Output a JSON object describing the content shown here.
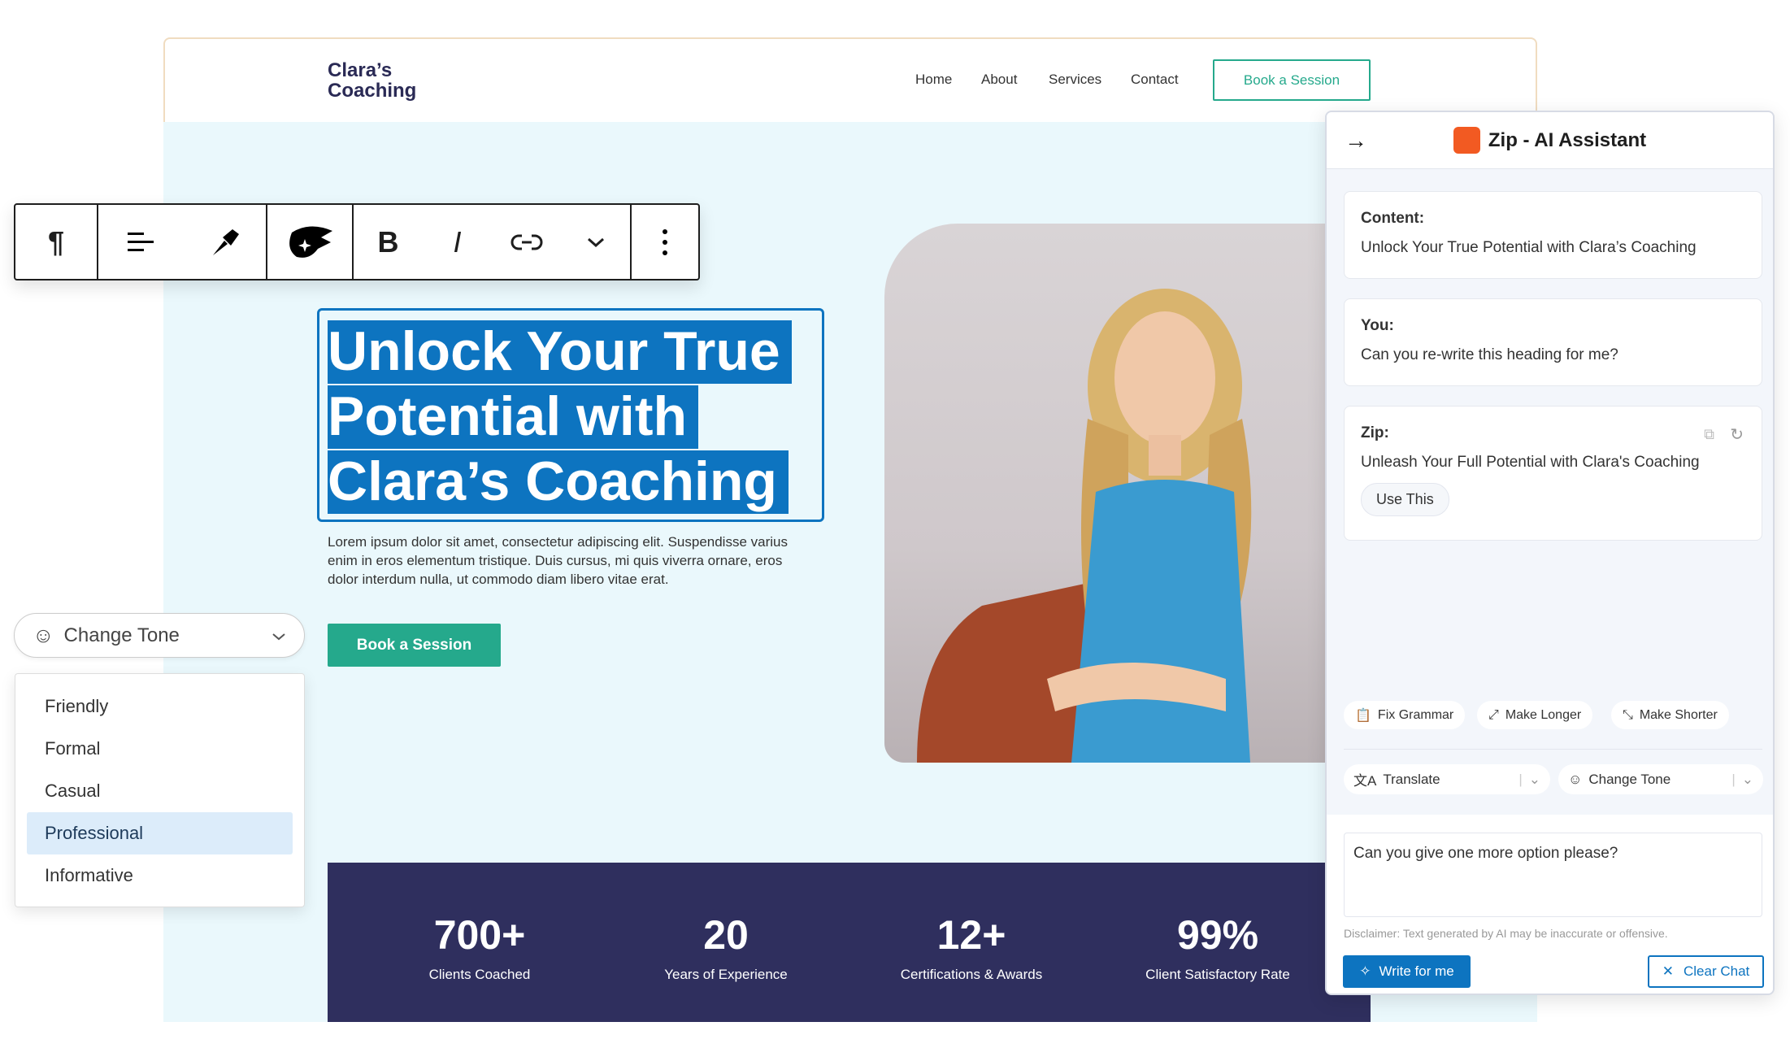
{
  "site": {
    "logo": "Clara’s Coaching",
    "nav": [
      "Home",
      "About",
      "Services",
      "Contact"
    ],
    "header_button": "Book a Session",
    "heading_lines": [
      "Unlock Your True",
      "Potential with",
      "Clara’s Coaching"
    ],
    "paragraph": "Lorem ipsum dolor sit amet, consectetur adipiscing elit. Suspendisse varius enim in eros elementum tristique. Duis cursus, mi quis viverra ornare, eros dolor interdum nulla, ut commodo diam libero vitae erat.",
    "hero_button": "Book a Session",
    "stats": [
      {
        "value": "700+",
        "label": "Clients Coached"
      },
      {
        "value": "20",
        "label": "Years of Experience"
      },
      {
        "value": "12+",
        "label": "Certifications & Awards"
      },
      {
        "value": "99%",
        "label": "Client Satisfactory Rate"
      }
    ]
  },
  "toolbar": {
    "icons": [
      "paragraph-icon",
      "align-icon",
      "paintbrush-icon",
      "zip-ai-icon",
      "bold-icon",
      "italic-icon",
      "link-icon",
      "chevron-down-icon",
      "more-options-icon"
    ],
    "bold": "B",
    "italic": "I"
  },
  "tone_dropdown": {
    "label": "Change Tone",
    "options": [
      "Friendly",
      "Formal",
      "Casual",
      "Professional",
      "Informative"
    ],
    "selected": "Professional"
  },
  "assistant": {
    "title": "Zip - AI Assistant",
    "messages": [
      {
        "label": "Content:",
        "text": "Unlock Your True Potential with Clara’s Coaching"
      },
      {
        "label": "You:",
        "text": "Can you re-write this heading for me?"
      },
      {
        "label": "Zip:",
        "text": "Unleash Your Full Potential with Clara's Coaching",
        "action": "Use This"
      }
    ],
    "chips": [
      "Fix Grammar",
      "Make Longer",
      "Make Shorter"
    ],
    "translate": "Translate",
    "change_tone": "Change Tone",
    "input_value": "Can you give one more option please?",
    "disclaimer": "Disclaimer: Text generated by AI may be inaccurate or offensive.",
    "write_button": "Write for me",
    "clear_button": "Clear Chat"
  },
  "colors": {
    "accent_green": "#25a98c",
    "selection_blue": "#0d74c0",
    "stats_bg": "#2f2f5e",
    "hero_bg": "#eaf8fc",
    "zip_orange": "#f25a22"
  }
}
